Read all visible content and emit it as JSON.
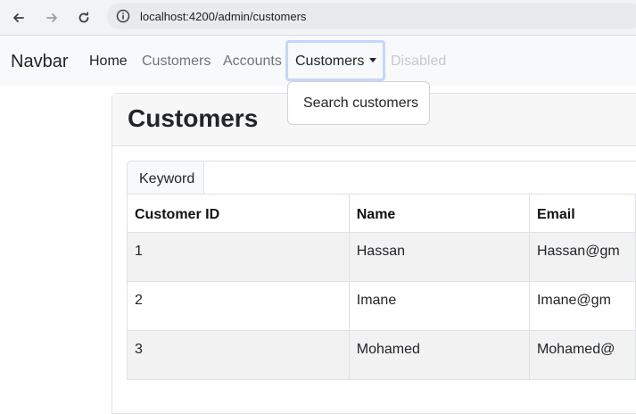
{
  "browser": {
    "url": "localhost:4200/admin/customers"
  },
  "navbar": {
    "brand": "Navbar",
    "links": {
      "home": "Home",
      "customers": "Customers",
      "accounts": "Accounts",
      "customers_dropdown": "Customers",
      "disabled": "Disabled"
    },
    "dropdown": {
      "items": [
        "Search customers"
      ]
    }
  },
  "card": {
    "title": "Customers",
    "keyword_label": "Keyword"
  },
  "table": {
    "headers": [
      "Customer ID",
      "Name",
      "Email"
    ],
    "rows": [
      [
        "1",
        "Hassan",
        "Hassan@gm"
      ],
      [
        "2",
        "Imane",
        "Imane@gm"
      ],
      [
        "3",
        "Mohamed",
        "Mohamed@"
      ]
    ]
  },
  "colors": {
    "navbar_bg": "#f8f9fa",
    "focus_ring": "#c2d7fb",
    "stripe": "#f2f2f2"
  }
}
